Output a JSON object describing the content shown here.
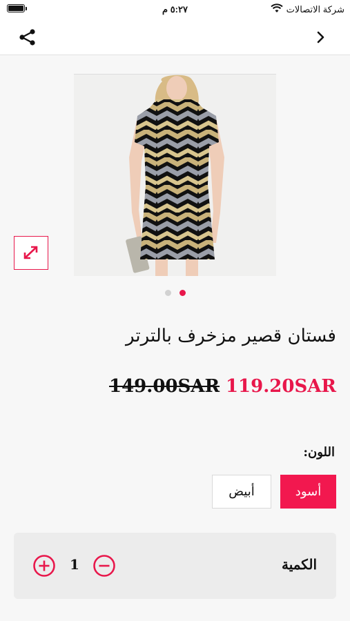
{
  "status_bar": {
    "carrier": "شركة الاتصالات",
    "time": "٥:٢٧ م",
    "icons": [
      "battery-icon",
      "wifi-icon"
    ]
  },
  "nav": {
    "icons": [
      "share-icon",
      "chevron-right-icon"
    ]
  },
  "gallery": {
    "image_alt": "dress-photo",
    "page_count": 2,
    "active_page": 2,
    "expand_icon": "expand-icon",
    "accent_color": "#e8174b"
  },
  "product": {
    "title": "فستان قصير مزخرف بالترتر",
    "sale_price": "119.20SAR",
    "original_price": "149.00SAR"
  },
  "color": {
    "label": "اللون:",
    "options": [
      {
        "label": "أسود",
        "selected": true
      },
      {
        "label": "أبيض",
        "selected": false
      }
    ]
  },
  "quantity": {
    "label": "الكمية",
    "value": "1",
    "icons": [
      "plus-circle-icon",
      "minus-circle-icon"
    ]
  }
}
